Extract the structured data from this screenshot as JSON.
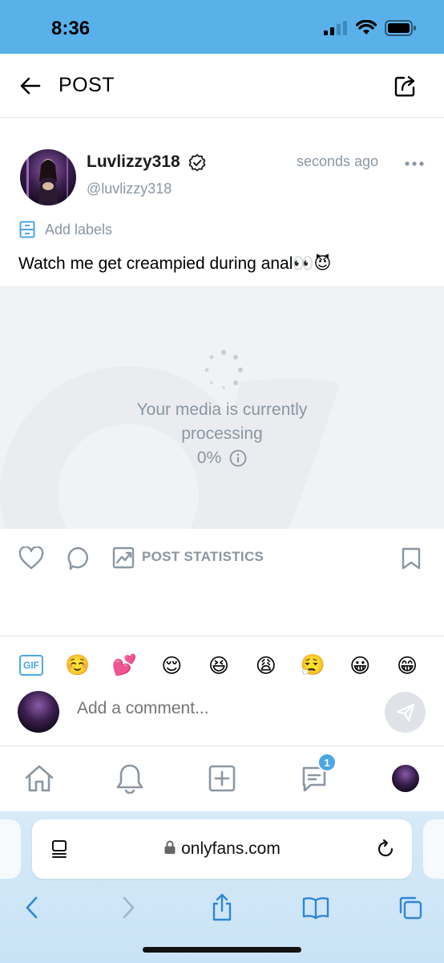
{
  "status_bar": {
    "time": "8:36"
  },
  "topbar": {
    "title": "POST"
  },
  "post": {
    "author_name": "Luvlizzy318",
    "author_handle": "@luvlizzy318",
    "timestamp": "seconds ago",
    "labels_text": "Add labels",
    "text": "Watch me get creampied during anal👀😈",
    "media": {
      "status_line1": "Your media is currently",
      "status_line2": "processing",
      "progress": "0%"
    }
  },
  "actions": {
    "stats_label": "POST STATISTICS"
  },
  "comment": {
    "placeholder": "Add a comment...",
    "gif_label": "GIF",
    "emojis": [
      "☺️",
      "💕",
      "😌",
      "😆",
      "😩",
      "😮‍💨",
      "😀",
      "😁"
    ]
  },
  "bottom_nav": {
    "messages_badge": "1"
  },
  "browser": {
    "url": "onlyfans.com"
  },
  "colors": {
    "accent": "#4ca6e6",
    "status_bar": "#5ab1ea",
    "muted_text": "#8a96a3"
  }
}
